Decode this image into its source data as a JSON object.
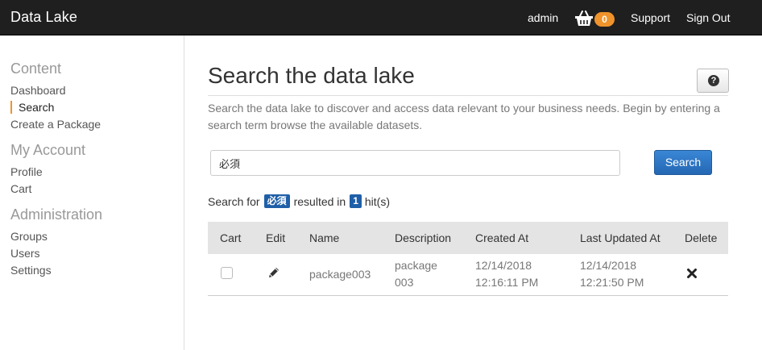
{
  "app": {
    "title": "Data Lake"
  },
  "topnav": {
    "user": "admin",
    "cart_count": "0",
    "support": "Support",
    "sign_out": "Sign Out"
  },
  "sidebar": {
    "sections": [
      {
        "title": "Content",
        "items": [
          "Dashboard",
          "Search",
          "Create a Package"
        ]
      },
      {
        "title": "My Account",
        "items": [
          "Profile",
          "Cart"
        ]
      },
      {
        "title": "Administration",
        "items": [
          "Groups",
          "Users",
          "Settings"
        ]
      }
    ],
    "active_item": "Search"
  },
  "main": {
    "title": "Search the data lake",
    "help_icon": "question-circle-icon",
    "intro": "Search the data lake to discover and access data relevant to your business needs. Begin by entering a search term browse the available datasets.",
    "search": {
      "value": "必須",
      "button": "Search"
    },
    "result": {
      "prefix": "Search for",
      "term": "必須",
      "middle": "resulted in",
      "count": "1",
      "suffix": "hit(s)"
    },
    "table": {
      "headers": [
        "Cart",
        "Edit",
        "Name",
        "Description",
        "Created At",
        "Last Updated At",
        "Delete"
      ],
      "rows": [
        {
          "name": "package003",
          "description_line1": "package",
          "description_line2": "003",
          "created_date": "12/14/2018",
          "created_time": "12:16:11 PM",
          "updated_date": "12/14/2018",
          "updated_time": "12:21:50 PM"
        }
      ]
    }
  },
  "colors": {
    "topbar": "#1f1f1f",
    "accent": "#f0932b",
    "primary": "#2467b3"
  }
}
